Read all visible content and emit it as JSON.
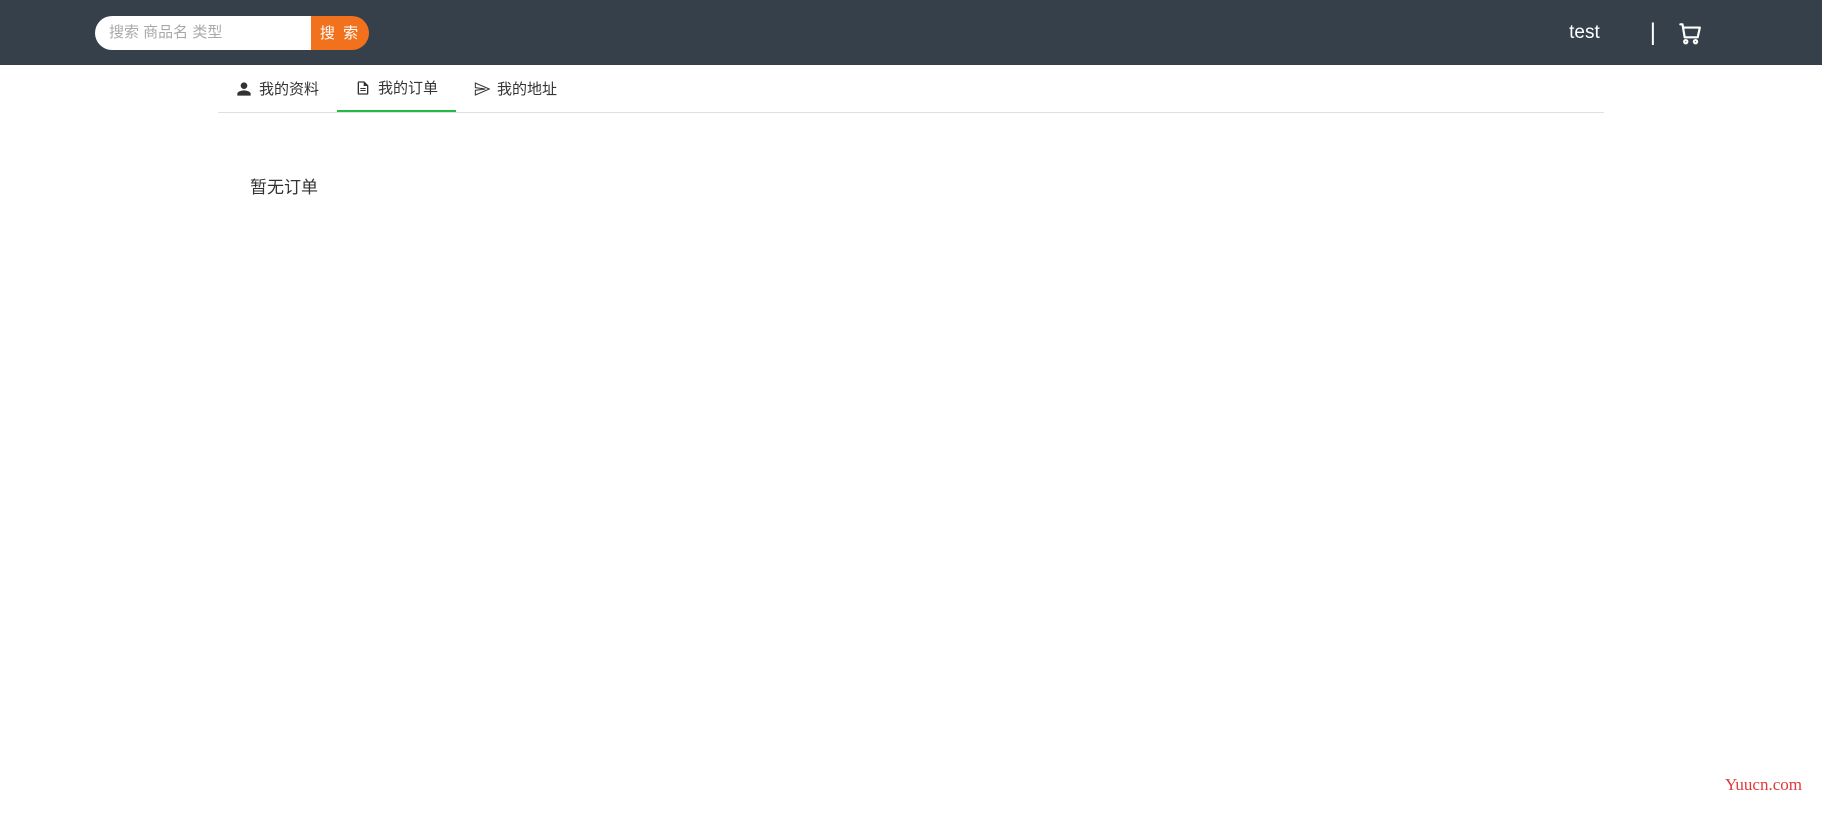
{
  "header": {
    "search_placeholder": "搜索 商品名 类型",
    "search_button_label": "搜 索",
    "user_label": "test",
    "divider": "|"
  },
  "tabs": {
    "profile": {
      "label": "我的资料"
    },
    "orders": {
      "label": "我的订单"
    },
    "address": {
      "label": "我的地址"
    }
  },
  "content": {
    "empty_orders": "暂无订单"
  },
  "watermark": "Yuucn.com"
}
